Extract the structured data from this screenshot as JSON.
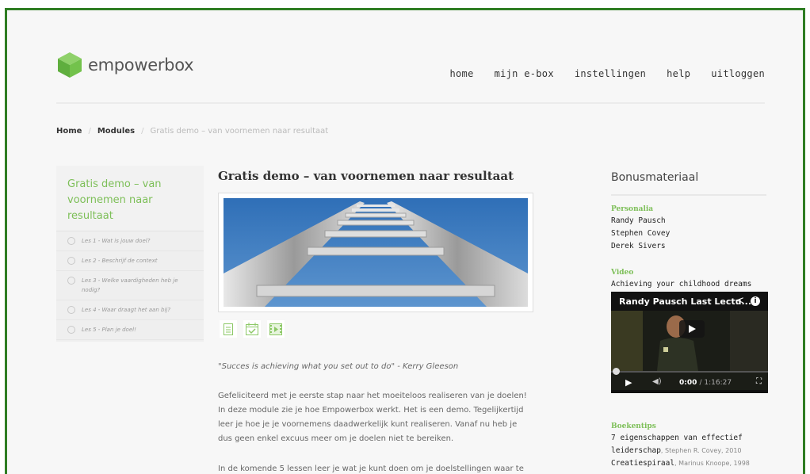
{
  "brand": {
    "name": "empowerbox",
    "accent": "#7dbf58",
    "frame": "#2f7d23"
  },
  "nav": [
    "home",
    "mijn e-box",
    "instellingen",
    "help",
    "uitloggen"
  ],
  "breadcrumb": {
    "home": "Home",
    "modules": "Modules",
    "current": "Gratis demo – van voornemen naar resultaat",
    "separator": "/"
  },
  "sidebar": {
    "title": "Gratis demo – van voornemen naar resultaat",
    "lessons": [
      "Les 1 - Wat is jouw doel?",
      "Les 2 - Beschrijf de context",
      "Les 3 - Welke vaardigheden heb je nodig?",
      "Les 4 - Waar draagt het aan bij?",
      "Les 5 - Plan je doel!"
    ]
  },
  "main": {
    "title": "Gratis demo – van voornemen naar resultaat",
    "quote": "\"Succes is achieving what you set out to do\" - Kerry Gleeson",
    "paragraphs": [
      "Gefeliciteerd met je eerste stap naar het moeiteloos realiseren van je doelen! In deze module zie je hoe Empowerbox werkt. Het is een demo. Tegelijkertijd leer je hoe je je voornemens daadwerkelijk kunt realiseren. Vanaf nu heb je dus geen enkel excuus meer om je doelen niet te bereiken.",
      "In de komende 5 lessen leer je wat je kunt doen om je doelstellingen waar te"
    ],
    "icons": [
      "document-icon",
      "calendar-check-icon",
      "film-icon"
    ]
  },
  "bonus": {
    "title": "Bonusmateriaal",
    "personalia_heading": "Personalia",
    "personalia": [
      "Randy Pausch",
      "Stephen Covey",
      "Derek Sivers"
    ],
    "video_heading": "Video",
    "video_caption": "Achieving your childhood dreams",
    "video": {
      "title": "Randy Pausch Last Lectu...",
      "current_time": "0:00",
      "duration": "/ 1:16:27",
      "progress": 0
    },
    "books_heading": "Boekentips",
    "books": [
      {
        "title": "7 eigenschappen van effectief leiderschap",
        "author": ", Stephen R. Covey, 2010"
      },
      {
        "title": "Creatiespiraal",
        "author": ", Marinus Knoope, 1998"
      }
    ]
  }
}
